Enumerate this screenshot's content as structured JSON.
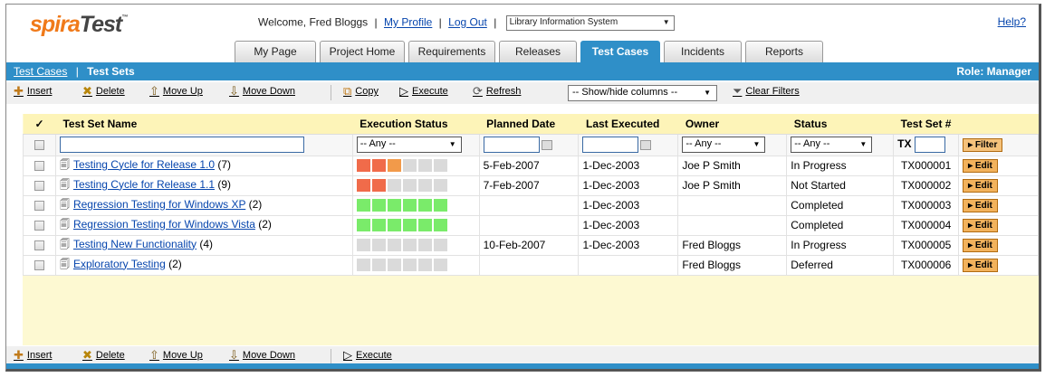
{
  "header": {
    "logo_part1": "spira",
    "logo_part2": "Test",
    "logo_tm": "™",
    "welcome_text": "Welcome, Fred Bloggs",
    "my_profile": "My Profile",
    "log_out": "Log Out",
    "project_selected": "Library Information System",
    "help": "Help?"
  },
  "tabs": [
    {
      "label": "My Page"
    },
    {
      "label": "Project Home"
    },
    {
      "label": "Requirements"
    },
    {
      "label": "Releases"
    },
    {
      "label": "Test Cases"
    },
    {
      "label": "Incidents"
    },
    {
      "label": "Reports"
    }
  ],
  "subnav": {
    "crumb_link": "Test Cases",
    "crumb_sep": "|",
    "crumb_current": "Test Sets",
    "role": "Role: Manager"
  },
  "toolbar": {
    "insert": "Insert",
    "delete": "Delete",
    "move_up": "Move Up",
    "move_down": "Move Down",
    "copy": "Copy",
    "execute": "Execute",
    "refresh": "Refresh",
    "columns_select": "-- Show/hide columns --",
    "clear_filters": "Clear Filters"
  },
  "grid": {
    "headers": {
      "check": "✓",
      "name": "Test Set Name",
      "exec_status": "Execution Status",
      "planned": "Planned Date",
      "last_exec": "Last Executed",
      "owner": "Owner",
      "status": "Status",
      "number": "Test Set #"
    },
    "filter": {
      "any1": "-- Any --",
      "any2": "-- Any --",
      "any3": "-- Any --",
      "tx": "TX",
      "filter_btn": "▸ Filter"
    },
    "edit_label": "▸ Edit",
    "rows": [
      {
        "name": "Testing Cycle for Release 1.0",
        "count": "(7)",
        "planned": "5-Feb-2007",
        "last": "1-Dec-2003",
        "owner": "Joe P Smith",
        "status": "In Progress",
        "id": "TX000001",
        "bars": [
          "#f06b4a",
          "#f06b4a",
          "#f29a4a",
          "#dadada",
          "#dadada",
          "#dadada"
        ]
      },
      {
        "name": "Testing Cycle for Release 1.1",
        "count": "(9)",
        "planned": "7-Feb-2007",
        "last": "1-Dec-2003",
        "owner": "Joe P Smith",
        "status": "Not Started",
        "id": "TX000002",
        "bars": [
          "#f06b4a",
          "#f06b4a",
          "#dadada",
          "#dadada",
          "#dadada",
          "#dadada"
        ]
      },
      {
        "name": "Regression Testing for Windows XP",
        "count": "(2)",
        "planned": "",
        "last": "1-Dec-2003",
        "owner": "",
        "status": "Completed",
        "id": "TX000003",
        "bars": [
          "#7aeb6a",
          "#7aeb6a",
          "#7aeb6a",
          "#7aeb6a",
          "#7aeb6a",
          "#7aeb6a"
        ]
      },
      {
        "name": "Regression Testing for Windows Vista",
        "count": "(2)",
        "planned": "",
        "last": "1-Dec-2003",
        "owner": "",
        "status": "Completed",
        "id": "TX000004",
        "bars": [
          "#7aeb6a",
          "#7aeb6a",
          "#7aeb6a",
          "#7aeb6a",
          "#7aeb6a",
          "#7aeb6a"
        ]
      },
      {
        "name": "Testing New Functionality",
        "count": "(4)",
        "planned": "10-Feb-2007",
        "last": "1-Dec-2003",
        "owner": "Fred Bloggs",
        "status": "In Progress",
        "id": "TX000005",
        "bars": [
          "#dadada",
          "#dadada",
          "#dadada",
          "#dadada",
          "#dadada",
          "#dadada"
        ]
      },
      {
        "name": "Exploratory Testing",
        "count": "(2)",
        "planned": "",
        "last": "",
        "owner": "Fred Bloggs",
        "status": "Deferred",
        "id": "TX000006",
        "bars": [
          "#dadada",
          "#dadada",
          "#dadada",
          "#dadada",
          "#dadada",
          "#dadada"
        ]
      }
    ]
  },
  "bottom_toolbar": {
    "insert": "Insert",
    "delete": "Delete",
    "move_up": "Move Up",
    "move_down": "Move Down",
    "execute": "Execute"
  },
  "colors": {
    "brand_blue": "#2f8fc8",
    "logo_orange": "#f07a1a",
    "grid_header": "#fdf4b8",
    "edit_button": "#f2b25c"
  }
}
